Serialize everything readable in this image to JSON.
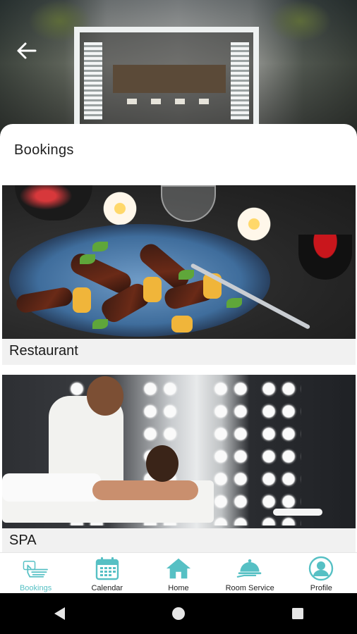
{
  "header": {
    "back_icon": "arrow-left-icon"
  },
  "page": {
    "title": "Bookings"
  },
  "cards": [
    {
      "label": "Restaurant",
      "image": "plated-food-photo"
    },
    {
      "label": "SPA",
      "image": "massage-spa-photo"
    }
  ],
  "bottom_nav": {
    "accent_color": "#56c0c4",
    "items": [
      {
        "label": "Bookings",
        "icon": "hand-touch-icon",
        "active": true
      },
      {
        "label": "Calendar",
        "icon": "calendar-icon",
        "active": false
      },
      {
        "label": "Home",
        "icon": "home-icon",
        "active": false
      },
      {
        "label": "Room Service",
        "icon": "cloche-icon",
        "active": false
      },
      {
        "label": "Profile",
        "icon": "user-circle-icon",
        "active": false
      }
    ]
  },
  "system_bar": {
    "buttons": [
      "back-triangle-icon",
      "home-circle-icon",
      "recents-square-icon"
    ]
  }
}
